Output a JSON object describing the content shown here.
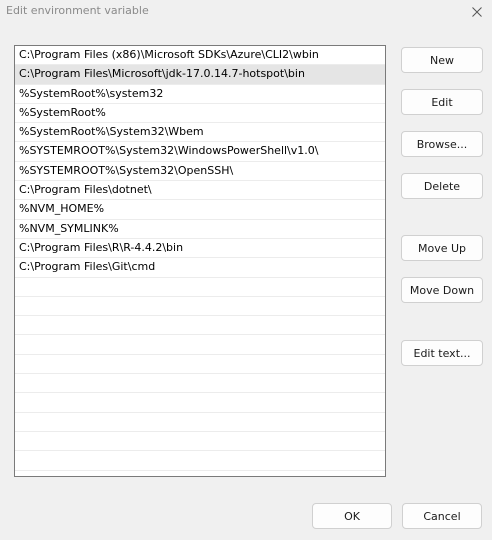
{
  "window": {
    "title": "Edit environment variable",
    "close_icon": "close-icon"
  },
  "list": {
    "selected_index": 1,
    "items": [
      "C:\\Program Files (x86)\\Microsoft SDKs\\Azure\\CLI2\\wbin",
      "C:\\Program Files\\Microsoft\\jdk-17.0.14.7-hotspot\\bin",
      "%SystemRoot%\\system32",
      "%SystemRoot%",
      "%SystemRoot%\\System32\\Wbem",
      "%SYSTEMROOT%\\System32\\WindowsPowerShell\\v1.0\\",
      "%SYSTEMROOT%\\System32\\OpenSSH\\",
      "C:\\Program Files\\dotnet\\",
      "%NVM_HOME%",
      "%NVM_SYMLINK%",
      "C:\\Program Files\\R\\R-4.4.2\\bin",
      "C:\\Program Files\\Git\\cmd",
      "",
      "",
      "",
      "",
      "",
      "",
      "",
      "",
      "",
      ""
    ]
  },
  "buttons": {
    "new": "New",
    "edit": "Edit",
    "browse": "Browse...",
    "delete": "Delete",
    "move_up": "Move Up",
    "move_down": "Move Down",
    "edit_text": "Edit text...",
    "ok": "OK",
    "cancel": "Cancel"
  }
}
